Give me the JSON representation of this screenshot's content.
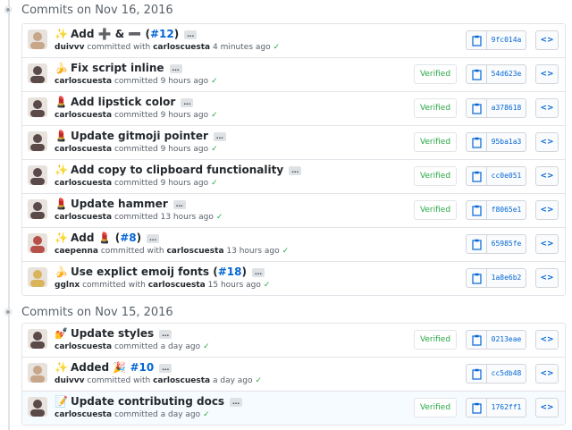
{
  "groups": [
    {
      "date_label": "Commits on Nov 16, 2016",
      "commits": [
        {
          "emoji": "✨",
          "title": "Add ➕ & ➖ (",
          "pr": "#12",
          "title_end": ")",
          "author": "duivvv",
          "verb": "committed with",
          "coauthor": "carloscuesta",
          "time": "4 minutes ago",
          "verified": "",
          "sha": "9fc014a",
          "avatar_color": "#c8a68a"
        },
        {
          "emoji": "🍌",
          "title": "Fix script inline",
          "pr": "",
          "title_end": "",
          "author": "carloscuesta",
          "verb": "committed",
          "coauthor": "",
          "time": "9 hours ago",
          "verified": "Verified",
          "sha": "54d623e",
          "avatar_color": "#5a4a48"
        },
        {
          "emoji": "💄",
          "title": "Add lipstick color",
          "pr": "",
          "title_end": "",
          "author": "carloscuesta",
          "verb": "committed",
          "coauthor": "",
          "time": "9 hours ago",
          "verified": "Verified",
          "sha": "a378618",
          "avatar_color": "#5a4a48"
        },
        {
          "emoji": "💄",
          "title": "Update gitmoji pointer",
          "pr": "",
          "title_end": "",
          "author": "carloscuesta",
          "verb": "committed",
          "coauthor": "",
          "time": "9 hours ago",
          "verified": "Verified",
          "sha": "95ba1a3",
          "avatar_color": "#5a4a48"
        },
        {
          "emoji": "✨",
          "title": "Add copy to clipboard functionality",
          "pr": "",
          "title_end": "",
          "author": "carloscuesta",
          "verb": "committed",
          "coauthor": "",
          "time": "9 hours ago",
          "verified": "Verified",
          "sha": "cc0e051",
          "avatar_color": "#5a4a48"
        },
        {
          "emoji": "💄",
          "title": "Update hammer",
          "pr": "",
          "title_end": "",
          "author": "carloscuesta",
          "verb": "committed",
          "coauthor": "",
          "time": "13 hours ago",
          "verified": "Verified",
          "sha": "f8065e1",
          "avatar_color": "#5a4a48"
        },
        {
          "emoji": "✨",
          "title": "Add 💄 (",
          "pr": "#8",
          "title_end": ")",
          "author": "caepenna",
          "verb": "committed with",
          "coauthor": "carloscuesta",
          "time": "13 hours ago",
          "verified": "",
          "sha": "65985fe",
          "avatar_color": "#b8504a"
        },
        {
          "emoji": "🍌",
          "title": "Use explict emoij fonts (",
          "pr": "#18",
          "title_end": ")",
          "author": "gglnx",
          "verb": "committed with",
          "coauthor": "carloscuesta",
          "time": "15 hours ago",
          "verified": "",
          "sha": "1a8e6b2",
          "avatar_color": "#d9b45a"
        }
      ]
    },
    {
      "date_label": "Commits on Nov 15, 2016",
      "commits": [
        {
          "emoji": "💅",
          "title": "Update styles",
          "pr": "",
          "title_end": "",
          "author": "carloscuesta",
          "verb": "committed",
          "coauthor": "",
          "time": "a day ago",
          "verified": "Verified",
          "sha": "0213eae",
          "avatar_color": "#5a4a48"
        },
        {
          "emoji": "✨",
          "title": "Added 🎉 ",
          "pr": "#10",
          "title_end": "",
          "author": "duivvv",
          "verb": "committed with",
          "coauthor": "carloscuesta",
          "time": "a day ago",
          "verified": "",
          "sha": "cc5db48",
          "avatar_color": "#c8a68a"
        },
        {
          "emoji": "📝",
          "title": "Update contributing docs",
          "pr": "",
          "title_end": "",
          "author": "carloscuesta",
          "verb": "committed",
          "coauthor": "",
          "time": "a day ago",
          "verified": "Verified",
          "sha": "1762ff1",
          "avatar_color": "#5a4a48",
          "highlight": true
        }
      ]
    }
  ],
  "labels": {
    "ellipsis": "…",
    "check": "✓",
    "browse": "<>"
  },
  "colors": {
    "link": "#0366d6",
    "verified": "#28a745",
    "border": "#e1e4e8"
  }
}
